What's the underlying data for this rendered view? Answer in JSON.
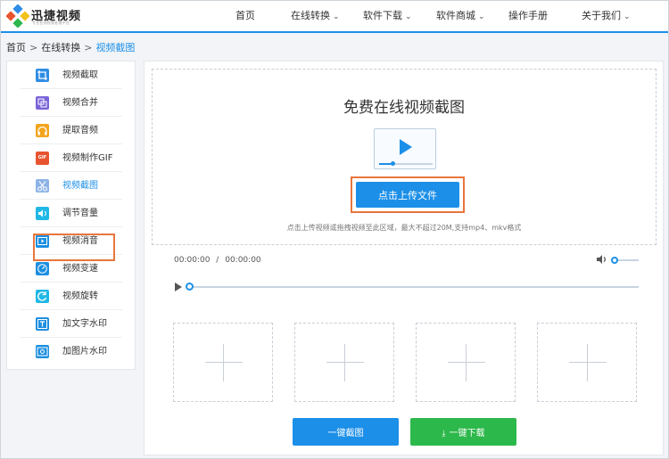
{
  "header": {
    "logo_title": "迅捷视频",
    "logo_subtitle": "专业在线视频处理平台",
    "nav": [
      {
        "label": "首页",
        "has_dropdown": false
      },
      {
        "label": "在线转换",
        "has_dropdown": true
      },
      {
        "label": "软件下载",
        "has_dropdown": true
      },
      {
        "label": "软件商城",
        "has_dropdown": true
      },
      {
        "label": "操作手册",
        "has_dropdown": false
      },
      {
        "label": "关于我们",
        "has_dropdown": true
      }
    ],
    "chevron_glyph": "⌄"
  },
  "breadcrumb": {
    "items": [
      "首页",
      "在线转换",
      "视频截图"
    ],
    "separator": ">"
  },
  "sidebar": {
    "items": [
      {
        "label": "视频截取",
        "icon": "crop-icon",
        "color": "#2f8de4"
      },
      {
        "label": "视频合并",
        "icon": "merge-icon",
        "color": "#7a63d8"
      },
      {
        "label": "提取音频",
        "icon": "headphones-icon",
        "color": "#f3a51e"
      },
      {
        "label": "视频制作GIF",
        "icon": "gif-icon",
        "color": "#e8542f",
        "glyph": "GIF"
      },
      {
        "label": "视频截图",
        "icon": "scissors-icon",
        "color": "#8db3e6",
        "active": true
      },
      {
        "label": "调节音量",
        "icon": "volume-icon",
        "color": "#20b8e6"
      },
      {
        "label": "视频消音",
        "icon": "mute-video-icon",
        "color": "#1d8fe0"
      },
      {
        "label": "视频变速",
        "icon": "speed-gauge-icon",
        "color": "#1d8fe0"
      },
      {
        "label": "视频旋转",
        "icon": "rotate-icon",
        "color": "#20b8e6"
      },
      {
        "label": "加文字水印",
        "icon": "text-watermark-icon",
        "color": "#1d8fe0"
      },
      {
        "label": "加图片水印",
        "icon": "image-watermark-icon",
        "color": "#1d8fe0"
      }
    ]
  },
  "main": {
    "title": "免费在线视频截图",
    "upload_button": "点击上传文件",
    "hint": "点击上传视频或拖拽视频至此区域，最大不超过20M,支持mp4、mkv格式",
    "player": {
      "current_time": "00:00:00",
      "total_time": "00:00:00",
      "separator": "/",
      "progress": 0,
      "volume": 0
    },
    "thumbnail_slots": 4,
    "actions": {
      "capture": "一键截图",
      "download": "一键下载"
    }
  },
  "colors": {
    "accent": "#1c8fe8",
    "highlight": "#e8763d",
    "download": "#2db84b"
  }
}
